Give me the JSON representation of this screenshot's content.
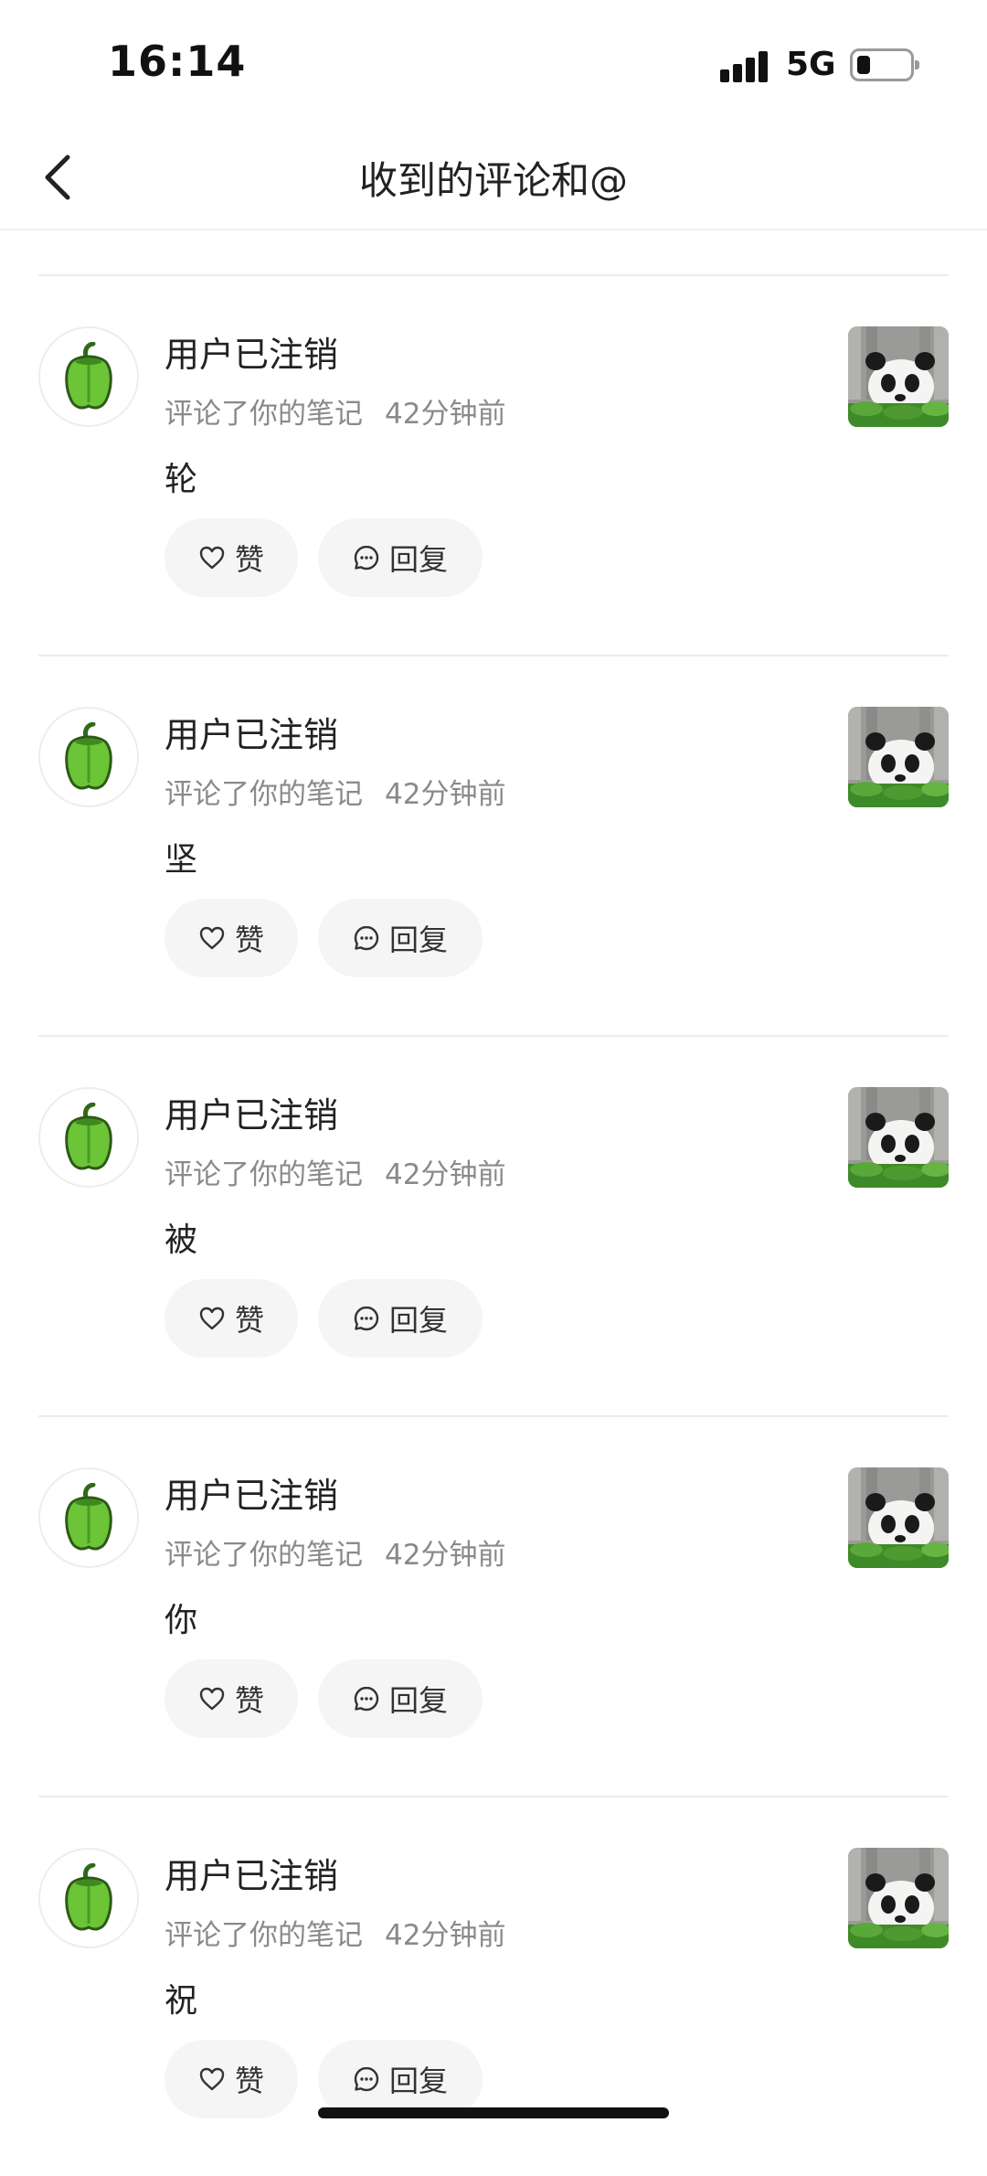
{
  "status_bar": {
    "time": "16:14",
    "network": "5G"
  },
  "nav": {
    "title": "收到的评论和@"
  },
  "notifications": [
    {
      "user": "用户已注销",
      "action": "评论了你的笔记",
      "time_ago": "42分钟前",
      "comment": "轮",
      "like_label": "赞",
      "reply_label": "回复"
    },
    {
      "user": "用户已注销",
      "action": "评论了你的笔记",
      "time_ago": "42分钟前",
      "comment": "坚",
      "like_label": "赞",
      "reply_label": "回复"
    },
    {
      "user": "用户已注销",
      "action": "评论了你的笔记",
      "time_ago": "42分钟前",
      "comment": "被",
      "like_label": "赞",
      "reply_label": "回复"
    },
    {
      "user": "用户已注销",
      "action": "评论了你的笔记",
      "time_ago": "42分钟前",
      "comment": "你",
      "like_label": "赞",
      "reply_label": "回复"
    },
    {
      "user": "用户已注销",
      "action": "评论了你的笔记",
      "time_ago": "42分钟前",
      "comment": "祝",
      "like_label": "赞",
      "reply_label": "回复"
    }
  ],
  "icons": {
    "back": "chevron-left-icon",
    "avatar": "green-pepper-icon",
    "like": "heart-icon",
    "reply": "comment-bubble-icon",
    "thumbnail": "panda-photo"
  }
}
